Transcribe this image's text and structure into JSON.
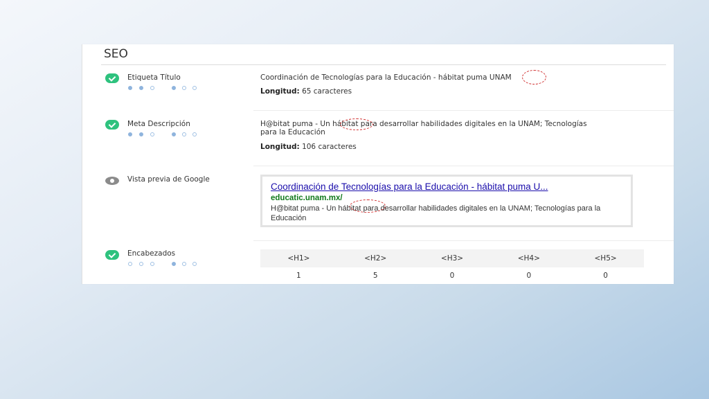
{
  "panel": {
    "title": "SEO"
  },
  "sections": {
    "title_tag": {
      "label": "Etiqueta Título",
      "value": "Coordinación de Tecnologías para la Educación - hábitat puma UNAM",
      "length_label": "Longitud:",
      "length_value": "65 caracteres"
    },
    "meta_description": {
      "label": "Meta Descripción",
      "value_line1": "H@bitat puma - Un hábitat para desarrollar habilidades digitales en la UNAM; Tecnologías",
      "value_line2": "para la Educación",
      "length_label": "Longitud:",
      "length_value": "106 caracteres"
    },
    "google_preview": {
      "label": "Vista previa de Google",
      "title": "Coordinación de Tecnologías para la Educación - hábitat puma U...",
      "url": "educatic.unam.mx/",
      "description": "H@bitat puma - Un hábitat para desarrollar habilidades digitales en la UNAM; Tecnologías para la Educación"
    },
    "headings": {
      "label": "Encabezados",
      "columns": [
        "<H1>",
        "<H2>",
        "<H3>",
        "<H4>",
        "<H5>"
      ],
      "counts": [
        "1",
        "5",
        "0",
        "0",
        "0"
      ]
    }
  },
  "colors": {
    "check": "#2ec27e",
    "link": "#1a0dab",
    "url": "#11791c",
    "annotation": "#d03030"
  },
  "icons": {
    "status_ok": "check-circle-icon",
    "preview": "eye-icon"
  }
}
